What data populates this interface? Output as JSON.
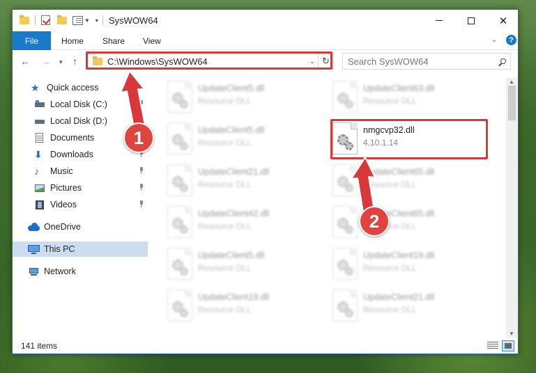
{
  "window": {
    "title": "SysWOW64"
  },
  "ribbon": {
    "tabs": [
      "File",
      "Home",
      "Share",
      "View"
    ],
    "help": "?"
  },
  "address": {
    "path": "C:\\Windows\\SysWOW64"
  },
  "search": {
    "placeholder": "Search SysWOW64"
  },
  "sidebar": {
    "quick_access": "Quick access",
    "items": [
      {
        "label": "Local Disk (C:)",
        "pinned": true
      },
      {
        "label": "Local Disk (D:)",
        "pinned": true
      },
      {
        "label": "Documents",
        "pinned": true
      },
      {
        "label": "Downloads",
        "pinned": true
      },
      {
        "label": "Music",
        "pinned": true
      },
      {
        "label": "Pictures",
        "pinned": true
      },
      {
        "label": "Videos",
        "pinned": true
      }
    ],
    "onedrive": "OneDrive",
    "this_pc": "This PC",
    "network": "Network"
  },
  "files": {
    "left": [
      {
        "name": "UpdateClient5.dll",
        "type": "Resource DLL"
      },
      {
        "name": "UpdateClient5.dll",
        "type": "Resource DLL"
      },
      {
        "name": "UpdateClient21.dll",
        "type": "Resource DLL"
      },
      {
        "name": "UpdateClient42.dll",
        "type": "Resource DLL"
      },
      {
        "name": "UpdateClient5.dll",
        "type": "Resource DLL"
      },
      {
        "name": "UpdateClient19.dll",
        "type": "Resource DLL"
      }
    ],
    "right": [
      {
        "name": "UpdateClient63.dll",
        "type": "Resource DLL"
      },
      {
        "name": "nmgcvp32.dll",
        "type": "4.10.1.14"
      },
      {
        "name": "UpdateClient65.dll",
        "type": "Resource DLL"
      },
      {
        "name": "UpdateClient65.dll",
        "type": "Resource DLL"
      },
      {
        "name": "UpdateClient19.dll",
        "type": "Resource DLL"
      },
      {
        "name": "UpdateClient21.dll",
        "type": "Resource DLL"
      }
    ]
  },
  "status": {
    "count": "141 items"
  },
  "annotations": {
    "badge1": "1",
    "badge2": "2",
    "color": "#d9383a"
  }
}
